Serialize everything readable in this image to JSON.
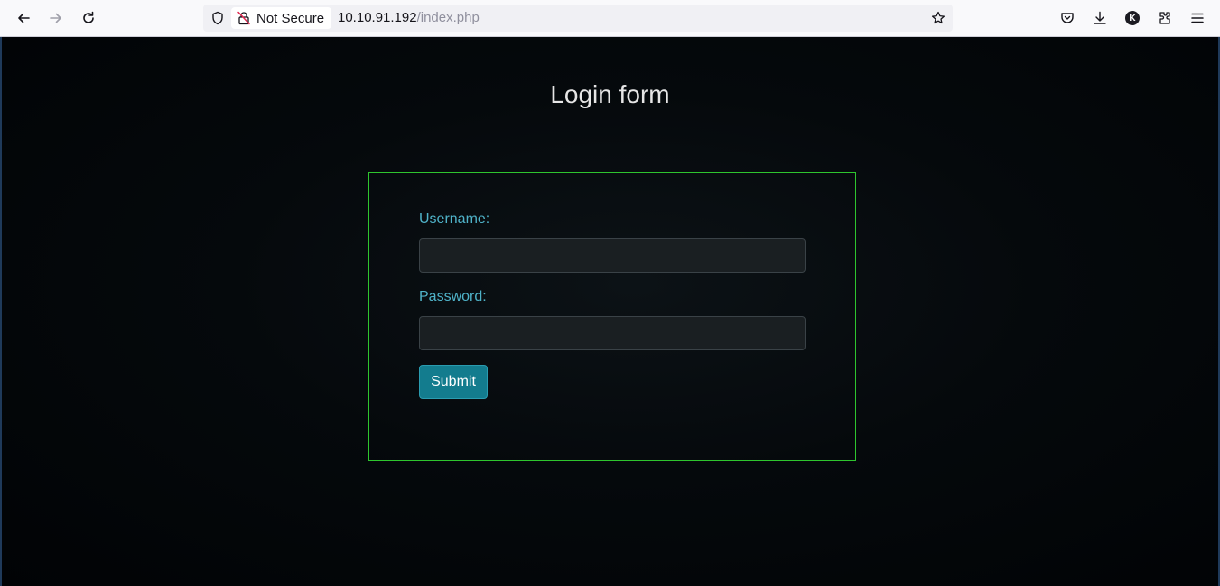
{
  "browser": {
    "security_label": "Not Secure",
    "url_host": "10.10.91.192",
    "url_path": "/index.php",
    "profile_initial": "K"
  },
  "page": {
    "title": "Login form",
    "form": {
      "username_label": "Username:",
      "username_value": "",
      "password_label": "Password:",
      "password_value": "",
      "submit_label": "Submit"
    }
  },
  "colors": {
    "form_border": "#2ec52e",
    "label_text": "#4fb3c9",
    "submit_bg": "#137c8e",
    "page_bg": "#05090c"
  },
  "icons": [
    "back-icon",
    "forward-icon",
    "reload-icon",
    "shield-icon",
    "insecure-lock-icon",
    "bookmark-star-icon",
    "pocket-icon",
    "download-icon",
    "account-icon",
    "extensions-icon",
    "menu-icon"
  ]
}
